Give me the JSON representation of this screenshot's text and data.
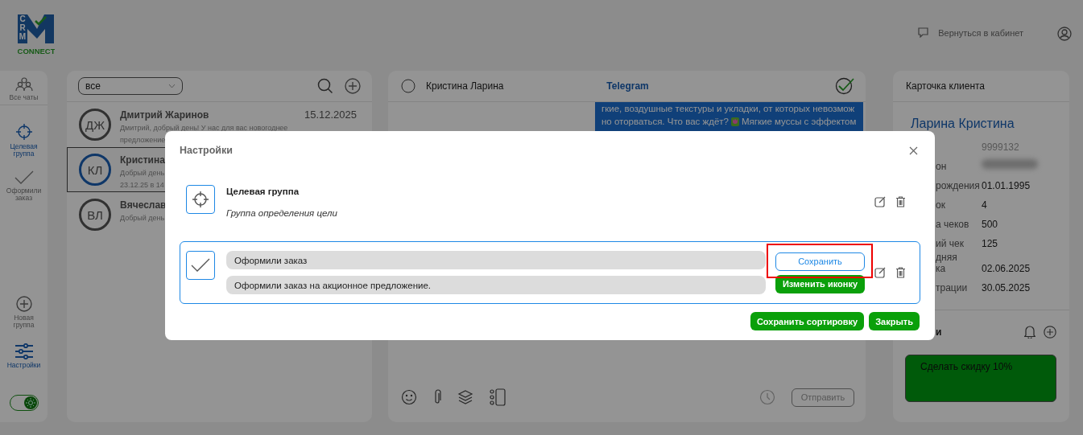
{
  "logo": {
    "mark": "CRM",
    "name": "CONNECT"
  },
  "header": {
    "back_link": "Вернуться в кабинет"
  },
  "sidebar": {
    "items": [
      {
        "label": "Все чаты",
        "selected": false
      },
      {
        "label": "Целевая группа",
        "selected": true
      },
      {
        "label": "Оформили заказ",
        "selected": false
      }
    ],
    "bottom_items": [
      {
        "label": "Новая группа",
        "selected": false
      },
      {
        "label": "Настройки",
        "selected": true
      }
    ],
    "theme_toggle": {
      "on": true
    }
  },
  "chat_list": {
    "filter": "все",
    "chats": [
      {
        "initials": "ДЖ",
        "name": "Дмитрий Жаринов",
        "preview_lines": [
          "Дмитрий, добрый день! У нас для вас новогоднее",
          "предложение"
        ],
        "date": "15.12.2025",
        "selected": false
      },
      {
        "initials": "КЛ",
        "name": "Кристина",
        "preview_lines": [
          "Добрый день",
          "23.12.25 в 14"
        ],
        "selected": true
      },
      {
        "initials": "ВЛ",
        "name": "Вячеслав",
        "preview_lines": [
          "Добрый день"
        ],
        "selected": false
      }
    ]
  },
  "chat": {
    "selected": false,
    "contact": "Кристина Ларина",
    "channel": "Telegram",
    "message_lines": [
      {
        "parts": [
          "гкие, воздушные текстуры и укладки, от которых невозмож"
        ]
      },
      {
        "parts": [
          "но оторваться. Что вас ждёт?",
          "Мягкие муссы с эффектом"
        ]
      }
    ],
    "send_button": {
      "label": "Отправить",
      "disabled": true
    }
  },
  "client_card": {
    "title": "Карточка клиента",
    "name": "Ларина Кристина",
    "fields": [
      {
        "kind": "id",
        "value": "9999132"
      },
      {
        "kind": "hidden",
        "label_lines": [
          "он"
        ]
      },
      {
        "kind": "text",
        "label_lines": [
          "рождения"
        ],
        "value": "01.01.1995"
      },
      {
        "kind": "text",
        "label_lines": [
          "ок"
        ],
        "value": "4"
      },
      {
        "kind": "text",
        "label_lines": [
          "а чеков"
        ],
        "value": "500"
      },
      {
        "kind": "text",
        "label_lines": [
          "ий чек"
        ],
        "value": "125"
      },
      {
        "kind": "text",
        "label_lines": [
          "дняя",
          "ка"
        ],
        "value": "02.06.2025"
      },
      {
        "kind": "text",
        "label_lines": [
          "трации"
        ],
        "value": "30.05.2025"
      }
    ],
    "notes": {
      "title": "и",
      "items": [
        {
          "text": "Сделать скидку 10%"
        }
      ]
    }
  },
  "settings_dialog": {
    "title": "Настройки",
    "groups": [
      {
        "kind": "view",
        "title": "Целевая группа",
        "description": "Группа определения цели"
      },
      {
        "kind": "edit",
        "title": "Оформили заказ",
        "description": "Оформили заказ на акционное предложение.",
        "save_button": {
          "label": "Сохранить",
          "highlighted": true
        },
        "icon_button": "Изменить иконку"
      }
    ],
    "buttons": [
      "Сохранить сортировку",
      "Закрыть"
    ]
  }
}
